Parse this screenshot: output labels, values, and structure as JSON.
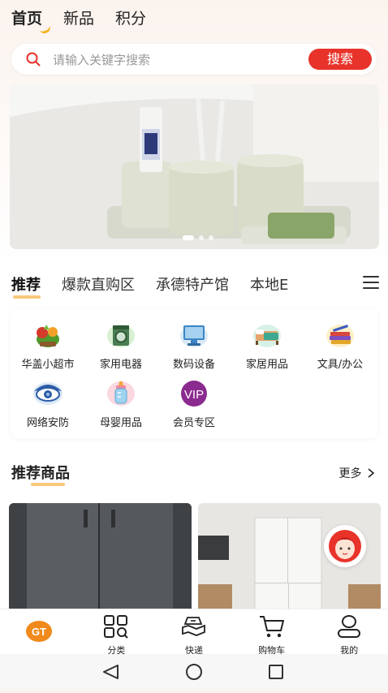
{
  "top_tabs": [
    {
      "label": "首页",
      "active": true
    },
    {
      "label": "新品",
      "active": false
    },
    {
      "label": "积分",
      "active": false
    }
  ],
  "search": {
    "placeholder": "请输入关键字搜索",
    "button_label": "搜索",
    "icon": "search-icon"
  },
  "banner": {
    "slide_count": 3,
    "active_slide": 1
  },
  "category_tabs": [
    {
      "label": "推荐",
      "active": true
    },
    {
      "label": "爆款直购区",
      "active": false
    },
    {
      "label": "承德特产馆",
      "active": false
    },
    {
      "label": "本地E",
      "active": false
    }
  ],
  "grid": [
    {
      "label": "华盖小超市",
      "icon": "vegetables-icon"
    },
    {
      "label": "家用电器",
      "icon": "washing-machine-icon"
    },
    {
      "label": "数码设备",
      "icon": "computer-icon"
    },
    {
      "label": "家居用品",
      "icon": "bed-icon"
    },
    {
      "label": "文具/办公",
      "icon": "stationery-icon"
    },
    {
      "label": "网络安防",
      "icon": "camera-icon"
    },
    {
      "label": "母婴用品",
      "icon": "baby-bottle-icon"
    },
    {
      "label": "会员专区",
      "icon": "vip-icon",
      "icon_text": "VIP"
    }
  ],
  "recommend": {
    "title": "推荐商品",
    "more_label": "更多"
  },
  "bottom_nav": [
    {
      "label": "",
      "icon": "gt-logo-icon",
      "icon_text": "GT"
    },
    {
      "label": "分类",
      "icon": "category-icon"
    },
    {
      "label": "快递",
      "icon": "express-icon"
    },
    {
      "label": "购物车",
      "icon": "cart-icon"
    },
    {
      "label": "我的",
      "icon": "user-icon"
    }
  ],
  "colors": {
    "accent": "#e8332a",
    "highlight": "#f7c77a",
    "logo": "#f08a1c"
  }
}
